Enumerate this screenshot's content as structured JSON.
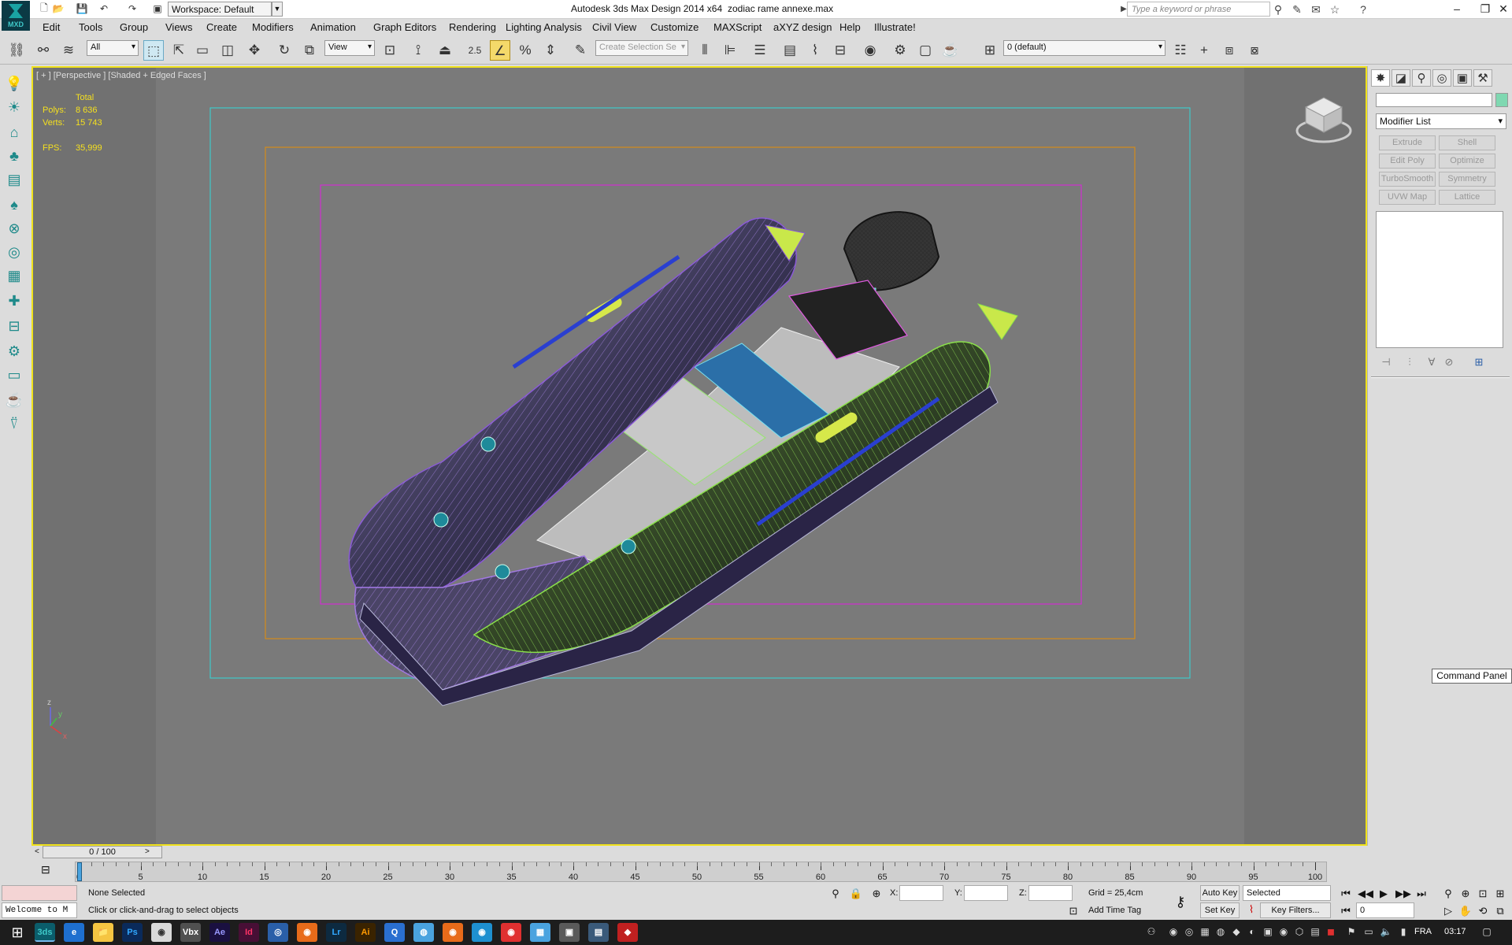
{
  "title_bar": {
    "app_title": "Autodesk 3ds Max Design 2014 x64",
    "file_name": "zodiac rame annexe.max",
    "workspace": "Workspace: Default",
    "search_placeholder": "Type a keyword or phrase",
    "logo_text": "MXD"
  },
  "menu": [
    "Edit",
    "Tools",
    "Group",
    "Views",
    "Create",
    "Modifiers",
    "Animation",
    "Graph Editors",
    "Rendering",
    "Lighting Analysis",
    "Civil View",
    "Customize",
    "MAXScript",
    "aXYZ design",
    "Help",
    "Illustrate!"
  ],
  "toolbar": {
    "filter": "All",
    "ref_coord": "View",
    "snap_value": "2.5",
    "selection_set_placeholder": "Create Selection Se",
    "layer": "0 (default)"
  },
  "viewport": {
    "label": "[ + ] [Perspective ] [Shaded + Edged Faces ]",
    "stats_header": "Total",
    "polys_label": "Polys:",
    "polys_value": "8 636",
    "verts_label": "Verts:",
    "verts_value": "15 743",
    "fps_label": "FPS:",
    "fps_value": "35,999",
    "border_color": "#f0e21c",
    "safe_frame_colors": [
      "#3fc9c9",
      "#d48a1a",
      "#d02fd0"
    ]
  },
  "command_panel": {
    "modifier_list": "Modifier List",
    "buttons": [
      "Extrude",
      "Shell",
      "Edit Poly",
      "Optimize",
      "TurboSmooth",
      "Symmetry",
      "UVW Map",
      "Lattice"
    ],
    "tooltip": "Command Panel"
  },
  "timeline": {
    "slider": "0 / 100",
    "ticks": [
      "0",
      "5",
      "10",
      "15",
      "20",
      "25",
      "30",
      "35",
      "40",
      "45",
      "50",
      "55",
      "60",
      "65",
      "70",
      "75",
      "80",
      "85",
      "90",
      "95",
      "100"
    ]
  },
  "status": {
    "selection": "None Selected",
    "prompt": "Click or click-and-drag to select objects",
    "maxscript": "Welcome to M",
    "x_label": "X:",
    "y_label": "Y:",
    "z_label": "Z:",
    "grid": "Grid = 25,4cm",
    "add_time_tag": "Add Time Tag",
    "auto_key": "Auto Key",
    "set_key": "Set Key",
    "key_mode": "Selected",
    "key_filters": "Key Filters...",
    "frame": "0"
  },
  "taskbar": {
    "apps": [
      "3ds",
      "e",
      "📁",
      "Ps",
      "◉",
      "Vbx",
      "Ae",
      "Id",
      "◎",
      "◉",
      "Lr",
      "Ai",
      "Q",
      "◍",
      "◉",
      "◉",
      "◉",
      "▦",
      "▣",
      "▤",
      "◆"
    ],
    "lang": "FRA",
    "time": "03:17"
  }
}
